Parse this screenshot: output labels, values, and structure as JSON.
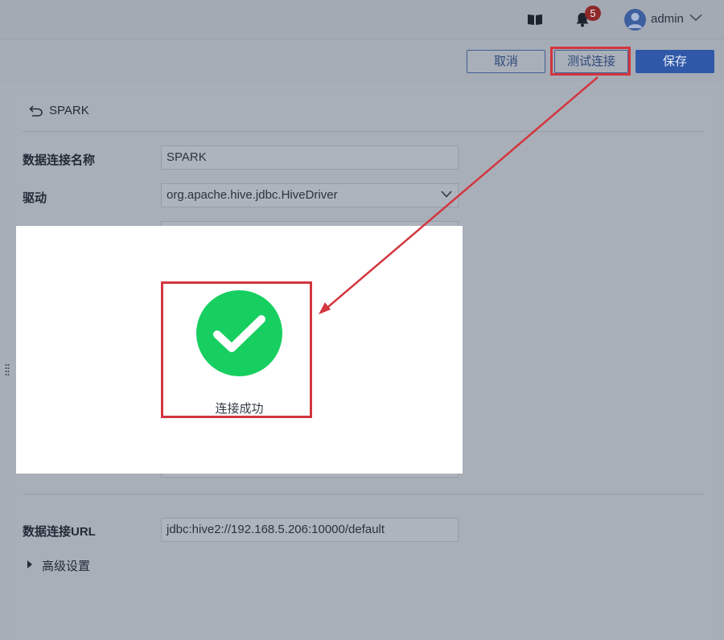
{
  "header": {
    "icons": [
      "book-icon",
      "bell-icon",
      "user-avatar-icon",
      "chevron-down-icon"
    ],
    "notification_count": "5",
    "user_name": "admin"
  },
  "toolbar": {
    "cancel_label": "取消",
    "test_label": "测试连接",
    "save_label": "保存"
  },
  "form": {
    "back_icon": "back-arrow-icon",
    "title": "SPARK",
    "name_label": "数据连接名称",
    "name_value": "SPARK",
    "driver_label": "驱动",
    "driver_value": "org.apache.hive.jdbc.HiveDriver",
    "url_label": "数据连接URL",
    "url_value": "jdbc:hive2://192.168.5.206:10000/default",
    "advanced_label": "高级设置"
  },
  "dialog": {
    "icon": "check-circle-icon",
    "message": "连接成功"
  },
  "colors": {
    "primary": "#2f59a8",
    "success": "#17cf60",
    "highlight": "#d2363f",
    "overlay_bg": "#a8aeb8"
  }
}
